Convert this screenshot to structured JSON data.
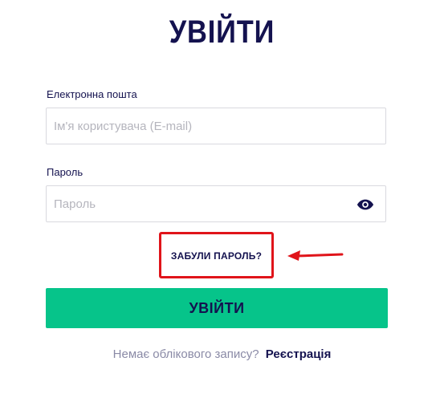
{
  "page": {
    "title": "УВІЙТИ"
  },
  "form": {
    "email_label": "Електронна пошта",
    "email_placeholder": "Ім'я користувача (E-mail)",
    "email_value": "",
    "password_label": "Пароль",
    "password_placeholder": "Пароль",
    "password_value": "",
    "forgot_label": "ЗАБУЛИ ПАРОЛЬ?",
    "submit_label": "УВІЙТИ"
  },
  "footer": {
    "no_account_text": "Немає облікового запису?",
    "register_label": "Реєстрація"
  },
  "icons": {
    "password_toggle": "eye-icon",
    "annotation": "arrow-left-icon"
  },
  "colors": {
    "text_primary": "#14124f",
    "accent_button": "#06c48a",
    "highlight_annotation": "#e0141a",
    "muted_text": "#8a8aa6"
  }
}
